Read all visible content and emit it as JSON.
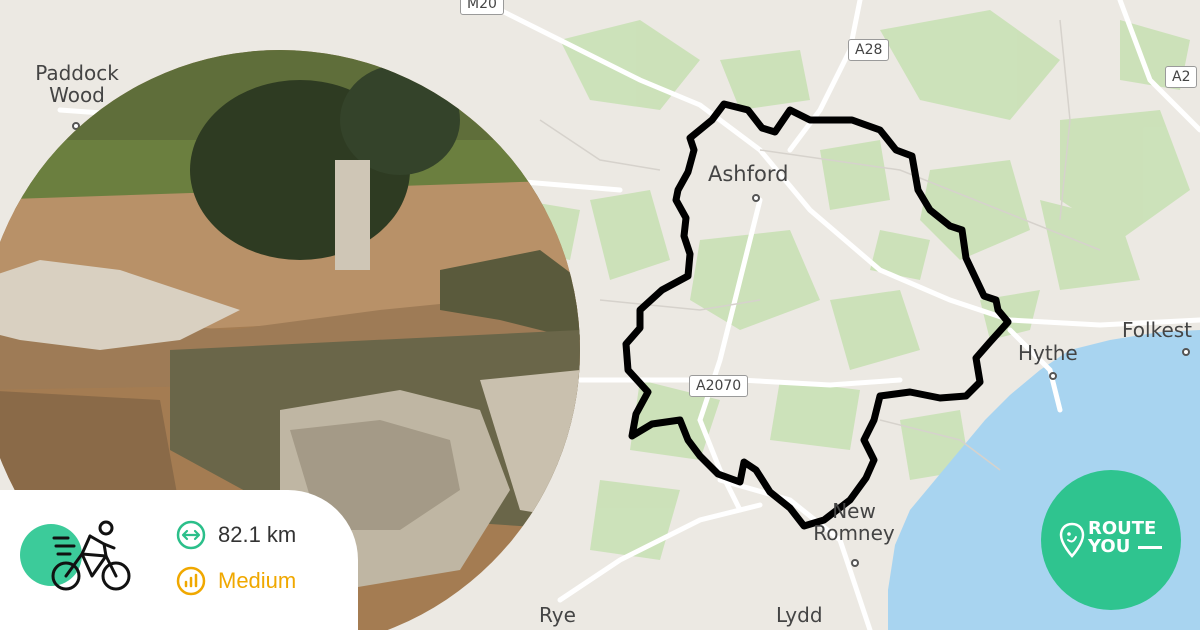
{
  "map": {
    "places": [
      {
        "id": "paddock-wood",
        "label": "Paddock Wood"
      },
      {
        "id": "ashford",
        "label": "Ashford"
      },
      {
        "id": "hythe",
        "label": "Hythe"
      },
      {
        "id": "folkestone",
        "label": "Folkest"
      },
      {
        "id": "new-romney",
        "label": "New Romney"
      },
      {
        "id": "rye",
        "label": "Rye"
      },
      {
        "id": "lydd",
        "label": "Lydd"
      }
    ],
    "roads": {
      "m20": "M20",
      "a28": "A28",
      "a2": "A2",
      "a2070": "A2070"
    },
    "colors": {
      "land": "#ece9e3",
      "green": "#c5dfb1",
      "sea": "#a8d4f0",
      "route": "#000000"
    }
  },
  "stats": {
    "activity_icon": "cyclist-icon",
    "distance": "82.1 km",
    "difficulty": "Medium",
    "distance_color": "#2bbf8a",
    "difficulty_color": "#f0a800"
  },
  "brand": {
    "line1": "ROUTE",
    "line2": "YOU",
    "color": "#2fc48f"
  }
}
